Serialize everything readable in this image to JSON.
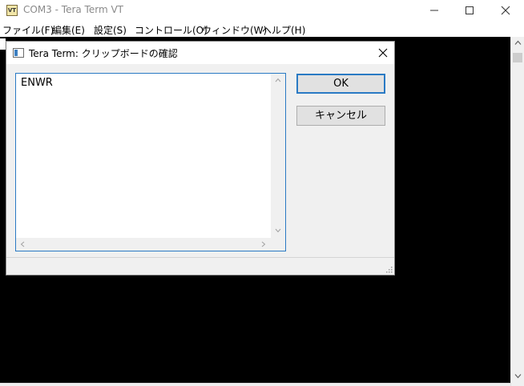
{
  "window": {
    "icon_text": "VT",
    "title": "COM3 - Tera Term VT"
  },
  "menu": {
    "items": [
      {
        "label": "ファイル(F)"
      },
      {
        "label": "編集(E)"
      },
      {
        "label": "設定(S)"
      },
      {
        "label": "コントロール(O)"
      },
      {
        "label": "ウィンドウ(W)"
      },
      {
        "label": "ヘルプ(H)"
      }
    ]
  },
  "dialog": {
    "title": "Tera Term: クリップボードの確認",
    "clipboard_text": "ENWR",
    "ok_label": "OK",
    "cancel_label": "キャンセル"
  },
  "icons": {
    "app": "tera-term-icon",
    "dialog": "window-icon",
    "close": "close-icon",
    "minimize": "minimize-icon",
    "maximize": "maximize-icon"
  },
  "colors": {
    "terminal_background": "#000000",
    "focus_accent": "#2a7ac4",
    "dialog_background": "#f0f0f0"
  }
}
